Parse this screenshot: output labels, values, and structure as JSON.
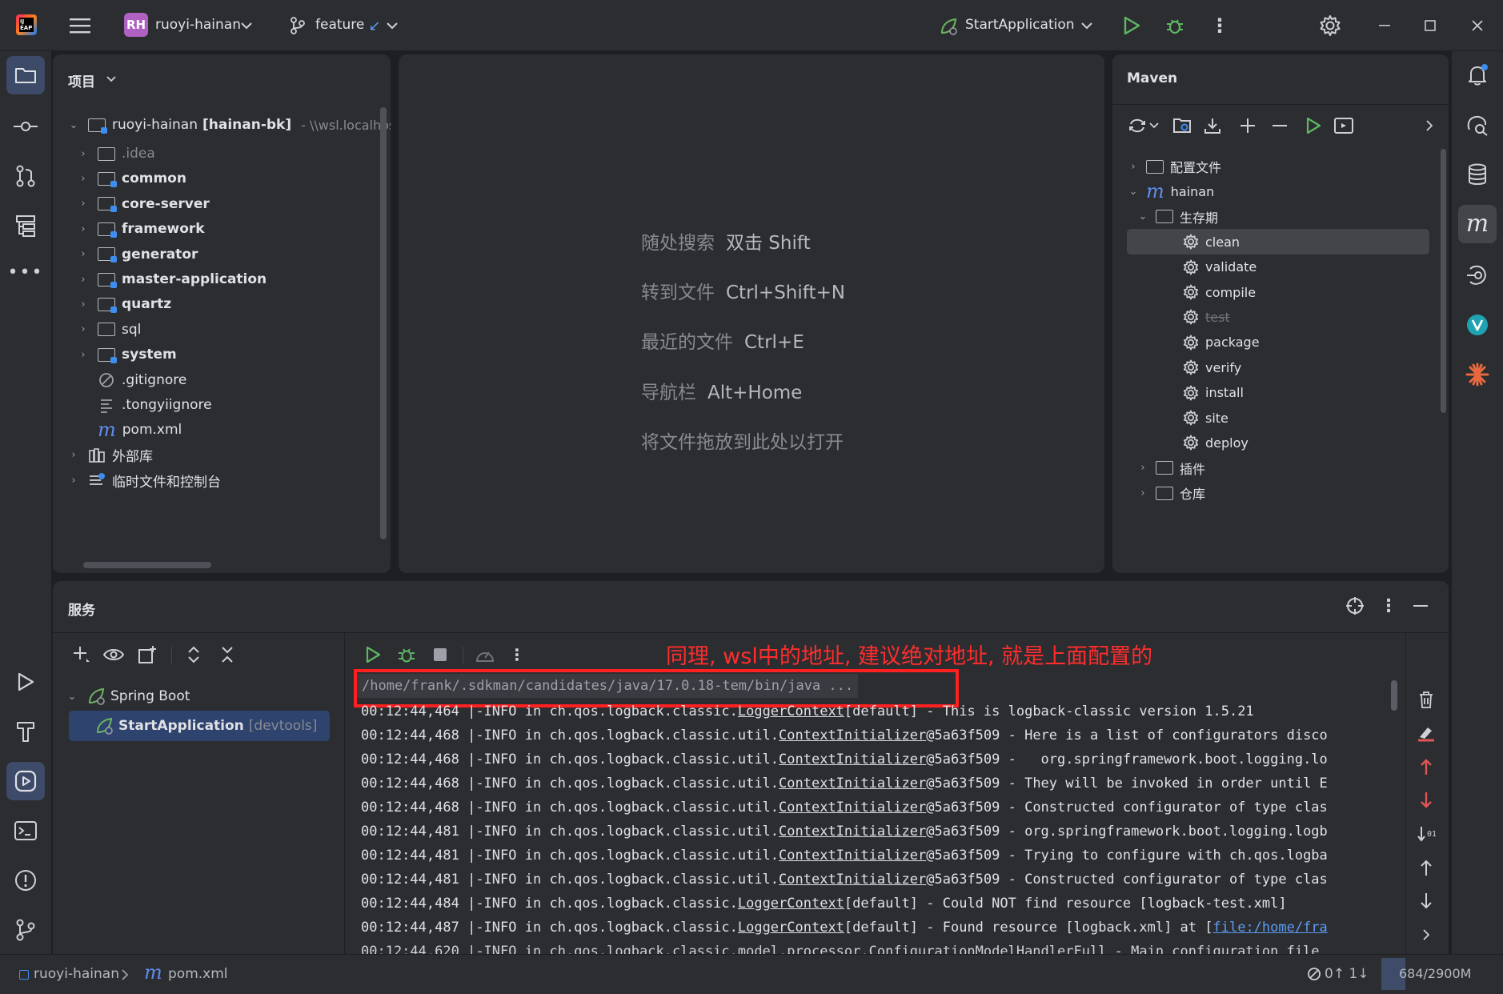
{
  "topbar": {
    "project_badge": "RH",
    "project_name": "ruoyi-hainan",
    "branch": "feature",
    "run_config": "StartApplication"
  },
  "project_panel": {
    "title": "项目",
    "root_name": "ruoyi-hainan",
    "root_module": "[hainan-bk]",
    "root_path": "- \\\\wsl.localhost\\",
    "items": [
      {
        "label": ".idea"
      },
      {
        "label": "common"
      },
      {
        "label": "core-server"
      },
      {
        "label": "framework"
      },
      {
        "label": "generator"
      },
      {
        "label": "master-application"
      },
      {
        "label": "quartz"
      },
      {
        "label": "sql"
      },
      {
        "label": "system"
      },
      {
        "label": ".gitignore"
      },
      {
        "label": ".tongyiignore"
      },
      {
        "label": "pom.xml"
      },
      {
        "label": "外部库"
      },
      {
        "label": "临时文件和控制台"
      }
    ]
  },
  "editor_hints": [
    {
      "label": "随处搜索",
      "key": "双击 Shift"
    },
    {
      "label": "转到文件",
      "key": "Ctrl+Shift+N"
    },
    {
      "label": "最近的文件",
      "key": "Ctrl+E"
    },
    {
      "label": "导航栏",
      "key": "Alt+Home"
    },
    {
      "label": "将文件拖放到此处以打开",
      "key": ""
    }
  ],
  "maven": {
    "title": "Maven",
    "profiles": "配置文件",
    "project": "hainan",
    "lifecycle": "生存期",
    "goals": [
      "clean",
      "validate",
      "compile",
      "test",
      "package",
      "verify",
      "install",
      "site",
      "deploy"
    ],
    "plugins": "插件",
    "repositories": "仓库"
  },
  "services": {
    "title": "服务",
    "group": "Spring Boot",
    "app": "StartApplication",
    "app_tag": "[devtools]",
    "annotation": "同理, wsl中的地址, 建议绝对地址, 就是上面配置的",
    "cmd": "/home/frank/.sdkman/candidates/java/17.0.18-tem/bin/java ...",
    "log_lines": [
      {
        "time": "00:12:44,464",
        "level": "|-INFO",
        "pre": "in ch.qos.logback.classic.",
        "link": "LoggerContext",
        "post": "[default] - This is logback-classic version 1.5.21"
      },
      {
        "time": "00:12:44,468",
        "level": "|-INFO",
        "pre": "in ch.qos.logback.classic.util.",
        "link": "ContextInitializer",
        "post": "@5a63f509 - Here is a list of configurators disco"
      },
      {
        "time": "00:12:44,468",
        "level": "|-INFO",
        "pre": "in ch.qos.logback.classic.util.",
        "link": "ContextInitializer",
        "post": "@5a63f509 -   org.springframework.boot.logging.lo"
      },
      {
        "time": "00:12:44,468",
        "level": "|-INFO",
        "pre": "in ch.qos.logback.classic.util.",
        "link": "ContextInitializer",
        "post": "@5a63f509 - They will be invoked in order until E"
      },
      {
        "time": "00:12:44,468",
        "level": "|-INFO",
        "pre": "in ch.qos.logback.classic.util.",
        "link": "ContextInitializer",
        "post": "@5a63f509 - Constructed configurator of type clas"
      },
      {
        "time": "00:12:44,481",
        "level": "|-INFO",
        "pre": "in ch.qos.logback.classic.util.",
        "link": "ContextInitializer",
        "post": "@5a63f509 - org.springframework.boot.logging.logb"
      },
      {
        "time": "00:12:44,481",
        "level": "|-INFO",
        "pre": "in ch.qos.logback.classic.util.",
        "link": "ContextInitializer",
        "post": "@5a63f509 - Trying to configure with ch.qos.logba"
      },
      {
        "time": "00:12:44,481",
        "level": "|-INFO",
        "pre": "in ch.qos.logback.classic.util.",
        "link": "ContextInitializer",
        "post": "@5a63f509 - Constructed configurator of type clas"
      },
      {
        "time": "00:12:44,484",
        "level": "|-INFO",
        "pre": "in ch.qos.logback.classic.",
        "link": "LoggerContext",
        "post": "[default] - Could NOT find resource [logback-test.xml]"
      },
      {
        "time": "00:12:44,487",
        "level": "|-INFO",
        "pre": "in ch.qos.logback.classic.",
        "link": "LoggerContext",
        "post": "[default] - Found resource [logback.xml] at [",
        "file": "file:/home/fra"
      },
      {
        "time": "00:12:44,620",
        "level": "|-INFO",
        "pre": "in ch.qos.logback.classic.model.processor.ConfigurationModelHandlerFull - Main configuration file",
        "link": "",
        "post": ""
      }
    ]
  },
  "statusbar": {
    "project": "ruoyi-hainan",
    "file": "pom.xml",
    "git": "0↑ 1↓",
    "memory": "684/2900M"
  },
  "colors": {
    "accent": "#3d8ef0",
    "run_green": "#5fb865",
    "annotation_red": "#ff2d2d"
  }
}
